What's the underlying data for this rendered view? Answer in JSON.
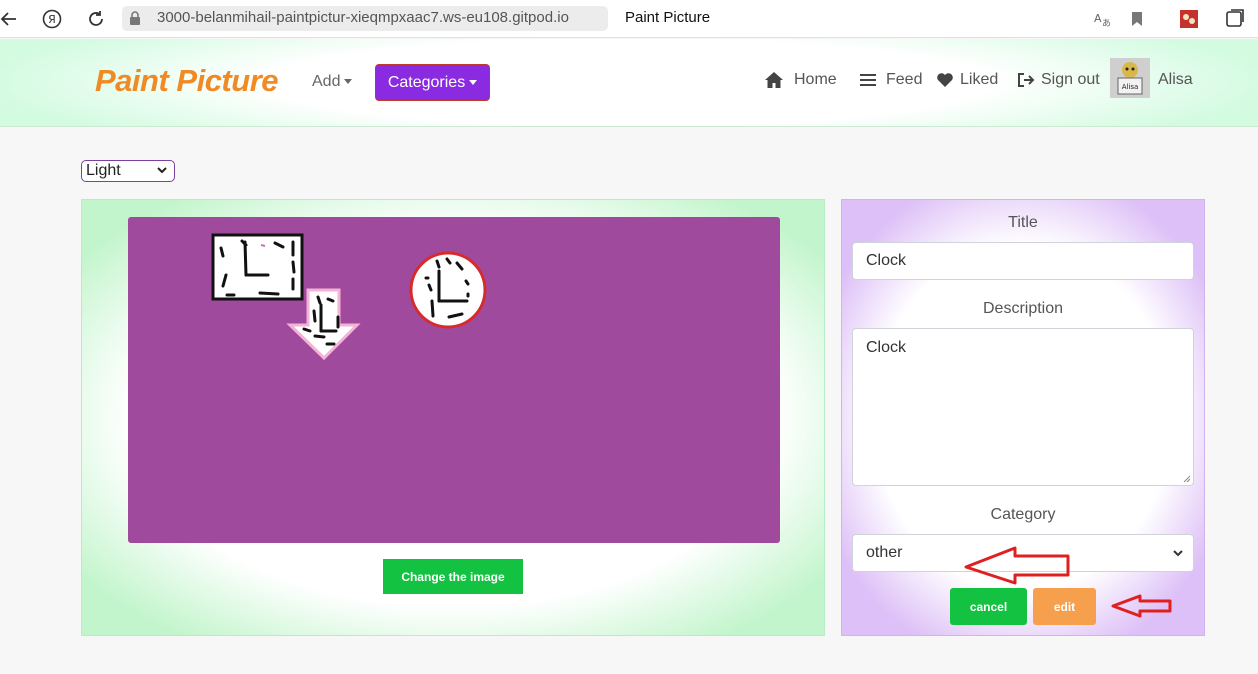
{
  "browser": {
    "url": "3000-belanmihail-paintpictur-xieqmpxaac7.ws-eu108.gitpod.io",
    "tab_title": "Paint Picture",
    "icons": [
      "back-arrow-icon",
      "yandex-icon",
      "reload-icon",
      "lock-icon",
      "translate-icon",
      "bookmark-icon",
      "extension-icon",
      "collections-icon"
    ]
  },
  "navbar": {
    "brand": "Paint Picture",
    "add_label": "Add",
    "categories_label": "Categories",
    "home_label": "Home",
    "feed_label": "Feed",
    "liked_label": "Liked",
    "signout_label": "Sign out",
    "user_name": "Alisa",
    "avatar_text": "Alisa"
  },
  "theme": {
    "selected": "Light"
  },
  "editor": {
    "change_image_label": "Change the image",
    "canvas_color": "#a04a9e"
  },
  "form": {
    "title_label": "Title",
    "title_value": "Clock",
    "description_label": "Description",
    "description_value": "Clock",
    "category_label": "Category",
    "category_value": "other",
    "cancel_label": "cancel",
    "edit_label": "edit"
  },
  "colors": {
    "brand": "#f08a24",
    "categories_button": "#8a2be2",
    "primary_green": "#14c241",
    "edit_orange": "#f6a04d",
    "annotation_red": "#e02020"
  }
}
